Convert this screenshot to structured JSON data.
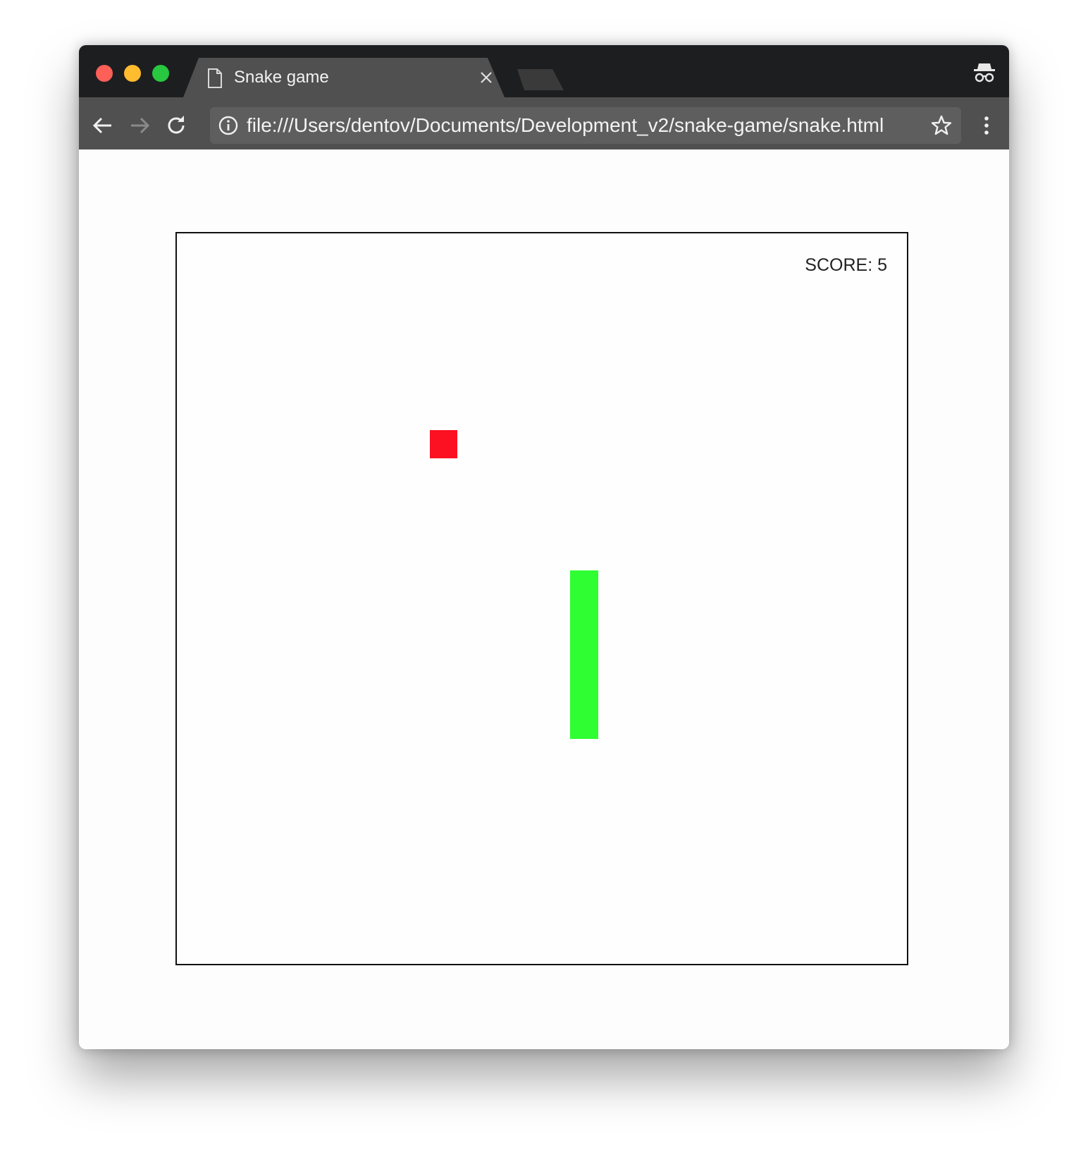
{
  "browser": {
    "tab": {
      "title": "Snake game",
      "page_icon": "page-icon",
      "close_icon": "close-icon"
    },
    "toolbar": {
      "back_icon": "back-arrow-icon",
      "forward_icon": "forward-arrow-icon",
      "reload_icon": "reload-icon",
      "address": "file:///Users/dentov/Documents/Development_v2/snake-game/snake.html",
      "info_icon": "info-icon",
      "bookmark_icon": "star-icon",
      "menu_icon": "more-vert-icon"
    },
    "profile_icon": "incognito-icon"
  },
  "game": {
    "score_text": "SCORE: 5",
    "grid_size": 26,
    "food": {
      "col": 9,
      "row": 7
    },
    "snake": [
      {
        "col": 14,
        "row": 12
      },
      {
        "col": 14,
        "row": 13
      },
      {
        "col": 14,
        "row": 14
      },
      {
        "col": 14,
        "row": 15
      },
      {
        "col": 14,
        "row": 16
      },
      {
        "col": 14,
        "row": 17
      }
    ]
  },
  "colors": {
    "traffic_close": "#fe5f57",
    "traffic_minimize": "#febc2e",
    "traffic_maximize": "#28c840",
    "active_tab": "#505050",
    "inactive_tab": "#3a3a3a",
    "food": "#fb1122",
    "snake": "#2ffe33"
  }
}
